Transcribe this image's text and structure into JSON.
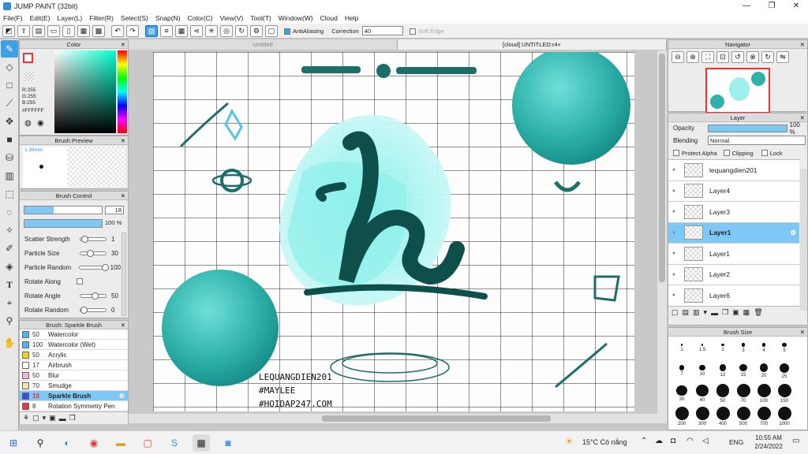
{
  "app": {
    "title": "JUMP PAINT (32bit)"
  },
  "menu": [
    "File(F)",
    "Edit(E)",
    "Layer(L)",
    "Filter(R)",
    "Select(S)",
    "Snap(N)",
    "Color(C)",
    "View(V)",
    "Tool(T)",
    "Window(W)",
    "Cloud",
    "Help"
  ],
  "toolbar": {
    "antialiasing_label": "AntiAliasing",
    "correction_label": "Correction",
    "correction_value": "40",
    "soft_edge_label": "Soft Edge"
  },
  "tabs": [
    "Untitled",
    "[cloud] UNTITLED:r4+"
  ],
  "color_panel": {
    "title": "Color",
    "r": "R:255",
    "g": "G:255",
    "b": "B:255",
    "hex": "#FFFFFF"
  },
  "brush_preview": {
    "title": "Brush Preview",
    "size": "1.38mm"
  },
  "brush_control": {
    "title": "Brush Control",
    "size_value": "18",
    "opacity_value": "100 %",
    "params": [
      {
        "label": "Scatter Strength",
        "value": "1",
        "frac": 0.02,
        "type": "slider"
      },
      {
        "label": "Particle Size",
        "value": "30",
        "frac": 0.3,
        "type": "slider"
      },
      {
        "label": "Particle Random",
        "value": "100",
        "frac": 1.0,
        "type": "slider"
      },
      {
        "label": "Rotate Along",
        "value": "",
        "frac": 0,
        "type": "check"
      },
      {
        "label": "Rotate Angle",
        "value": "50",
        "frac": 0.5,
        "type": "slider"
      },
      {
        "label": "Rotate Random",
        "value": "0",
        "frac": 0.0,
        "type": "slider"
      }
    ]
  },
  "brush_list": {
    "title": "Brush: Sparkle Brush",
    "items": [
      {
        "size": "50",
        "name": "Watercolor",
        "color": "#4fb6e8"
      },
      {
        "size": "100",
        "name": "Watercolor (Wet)",
        "color": "#4fb6e8"
      },
      {
        "size": "50",
        "name": "Acrylic",
        "color": "#f2d31b"
      },
      {
        "size": "17",
        "name": "Airbrush",
        "color": "#ffffff"
      },
      {
        "size": "50",
        "name": "Blur",
        "color": "#f4b6d4"
      },
      {
        "size": "70",
        "name": "Smudge",
        "color": "#f7e3a8"
      },
      {
        "size": "18",
        "name": "Sparkle Brush",
        "color": "#3a4be8",
        "selected": true
      },
      {
        "size": "8",
        "name": "Rotation Symmetry Pen",
        "color": "#e83a3a"
      }
    ]
  },
  "navigator": {
    "title": "Navigator"
  },
  "layer_panel": {
    "title": "Layer",
    "opacity_label": "Opacity",
    "opacity_value": "100 %",
    "opacity_frac": 1.0,
    "blending_label": "Blending",
    "blending_value": "Normal",
    "protect_alpha": "Protect Alpha",
    "clipping": "Clipping",
    "lock": "Lock",
    "layers": [
      {
        "name": "lequangdien201",
        "selected": false
      },
      {
        "name": "Layer4",
        "selected": false
      },
      {
        "name": "Layer3",
        "selected": false
      },
      {
        "name": "Layer1",
        "selected": true
      },
      {
        "name": "Layer1",
        "selected": false
      },
      {
        "name": "Layer2",
        "selected": false
      },
      {
        "name": "Layer6",
        "selected": false
      }
    ]
  },
  "brush_size": {
    "title": "Brush Size",
    "sizes": [
      "1",
      "1.5",
      "2",
      "3",
      "4",
      "5",
      "7",
      "10",
      "12",
      "15",
      "20",
      "25",
      "30",
      "40",
      "50",
      "70",
      "100",
      "150",
      "200",
      "300",
      "400",
      "500",
      "700",
      "1000"
    ]
  },
  "canvas_text": [
    "LEQUANGDIEN201",
    "#MAYLEE",
    "#HOIDAP247.COM"
  ],
  "taskbar": {
    "weather": "15°C Có nắng",
    "lang": "ENG",
    "time": "10:55 AM",
    "date": "2/24/2022"
  }
}
